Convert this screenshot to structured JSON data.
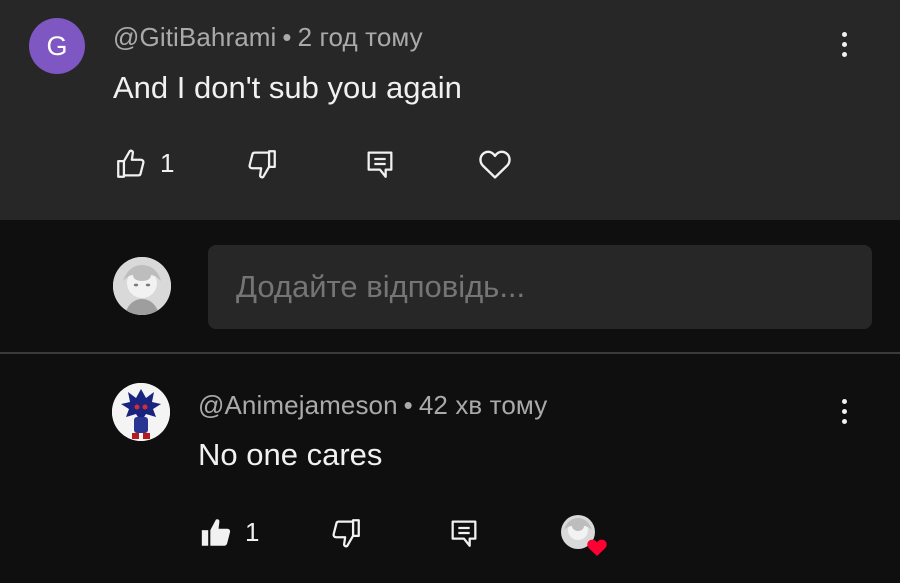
{
  "top_comment": {
    "avatar_letter": "G",
    "author": "@GitiBahrami",
    "separator": "•",
    "time": "2 год тому",
    "text": "And I don't sub you again",
    "like_count": "1",
    "icons": [
      "thumb-up-outline-icon",
      "thumb-down-outline-icon",
      "reply-icon",
      "heart-outline-icon",
      "more-vert-icon"
    ]
  },
  "reply_box": {
    "placeholder": "Додайте відповідь..."
  },
  "reply": {
    "author": "@Animejameson",
    "separator": "•",
    "time": "42 хв тому",
    "text": "No one cares",
    "like_count": "1",
    "icons": [
      "thumb-up-filled-icon",
      "thumb-down-outline-icon",
      "reply-icon",
      "creator-heart-icon",
      "more-vert-icon"
    ]
  },
  "colors": {
    "background": "#0f0f0f",
    "highlight_background": "#272727",
    "avatar_purple": "#7e57c2",
    "meta_text": "#aaaaaa",
    "heart_red": "#ff0033"
  }
}
